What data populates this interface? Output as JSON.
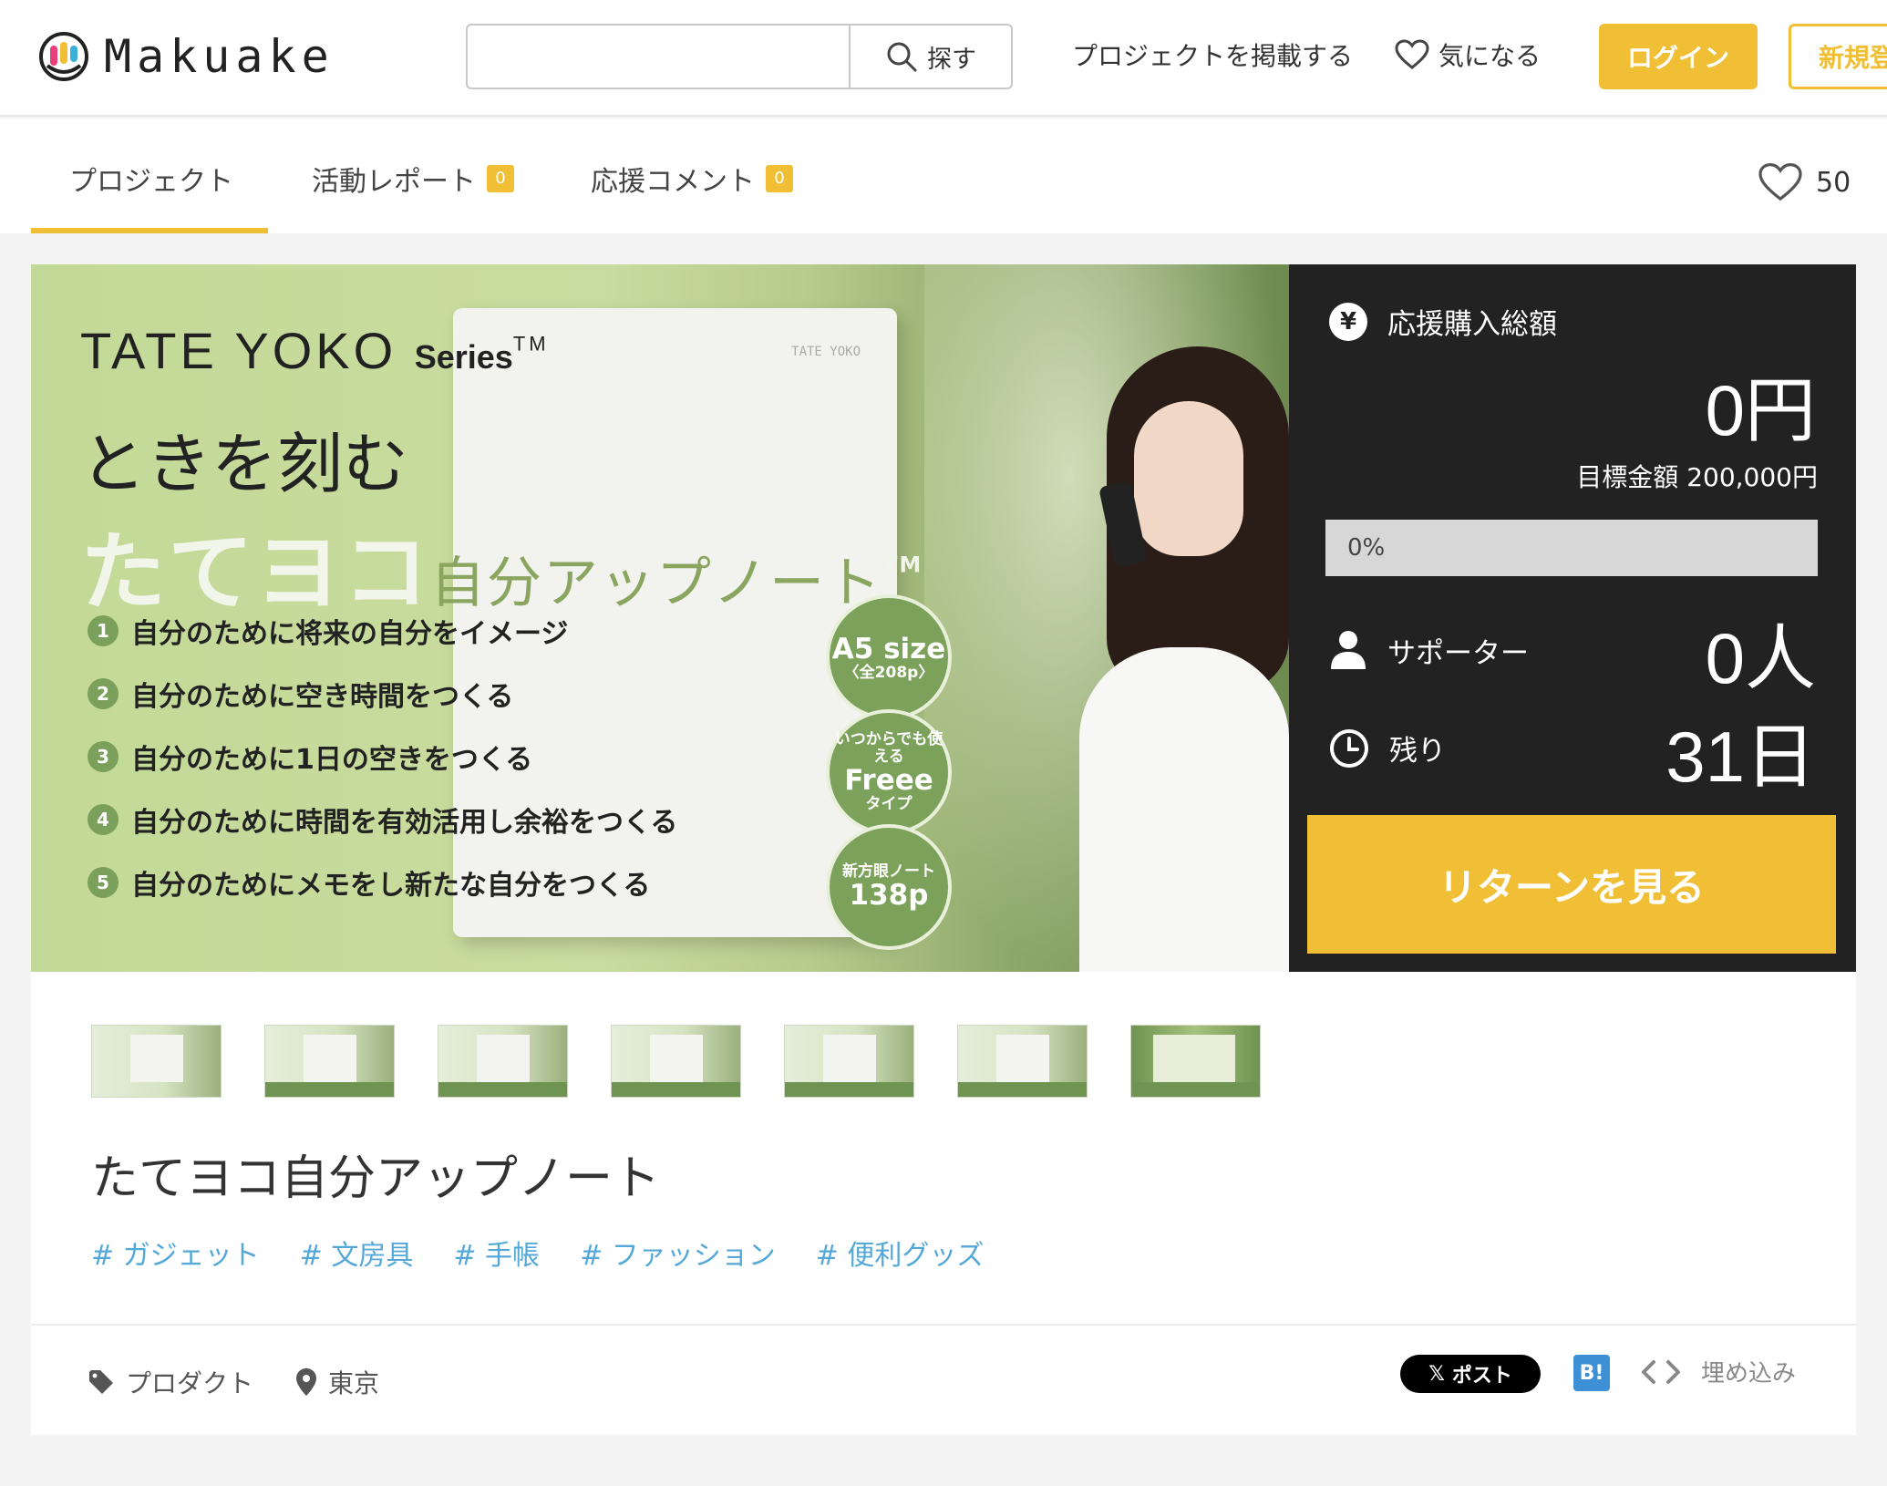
{
  "header": {
    "logo_text": "Makuake",
    "search": {
      "placeholder": "",
      "button_label": "探す"
    },
    "post_project_label": "プロジェクトを掲載する",
    "favorites_label": "気になる",
    "login_label": "ログイン",
    "signup_label": "新規登録"
  },
  "tabs": {
    "items": [
      {
        "label": "プロジェクト",
        "badge": null,
        "active": true
      },
      {
        "label": "活動レポート",
        "badge": "0"
      },
      {
        "label": "応援コメント",
        "badge": "0"
      }
    ],
    "favorite_count": "50"
  },
  "hero": {
    "brand_main": "TATE YOKO",
    "brand_series": "Series",
    "brand_tm": "TM",
    "tagline": "ときを刻む",
    "product_name_large": "たてヨコ",
    "product_name_small": "自分アップノート",
    "product_tm": "TM",
    "notebook_brand": "TATE YOKO",
    "features": [
      {
        "num": "1",
        "text": "自分のために将来の自分をイメージ"
      },
      {
        "num": "2",
        "text": "自分のために空き時間をつくる"
      },
      {
        "num": "3",
        "text": "自分のために1日の空きをつくる"
      },
      {
        "num": "4",
        "text": "自分のために時間を有効活用し余裕をつくる"
      },
      {
        "num": "5",
        "text": "自分のためにメモをし新たな自分をつくる"
      }
    ],
    "bubbles": [
      {
        "top": "",
        "main": "A5 size",
        "sub": "〈全208p〉"
      },
      {
        "top": "いつからでも使える",
        "main": "Freee",
        "sub": "タイプ"
      },
      {
        "top": "新方眼ノート",
        "main": "138p",
        "sub": ""
      }
    ]
  },
  "stats": {
    "total_label": "応援購入総額",
    "total_value": "0円",
    "goal_text": "目標金額 200,000円",
    "progress_text": "0%",
    "progress_fraction": 0,
    "supporters_label": "サポーター",
    "supporters_value": "0人",
    "remaining_label": "残り",
    "remaining_value": "31日",
    "return_button_label": "リターンを見る"
  },
  "project": {
    "title": "たてヨコ自分アップノート",
    "tags": [
      "# ガジェット",
      "# 文房具",
      "# 手帳",
      "# ファッション",
      "# 便利グッズ"
    ],
    "category": "プロダクト",
    "location": "東京",
    "share_x_label": "ポスト",
    "share_hatena_label": "B!",
    "embed_label": "埋め込み"
  },
  "colors": {
    "accent": "#f0bf36",
    "stats_bg": "#222222",
    "tag": "#53a8d8",
    "hero_green": "#7ca15b"
  }
}
